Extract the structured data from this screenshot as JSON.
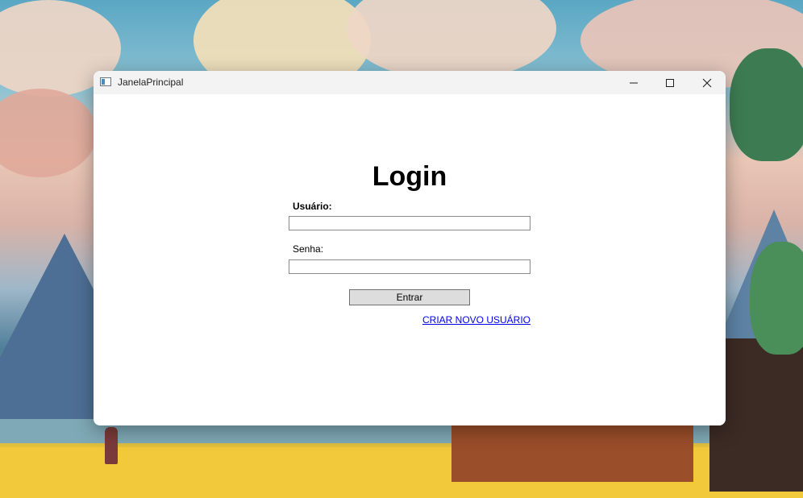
{
  "window": {
    "title": "JanelaPrincipal"
  },
  "titlebar_buttons": {
    "minimize_icon": "minimize-icon",
    "maximize_icon": "maximize-icon",
    "close_icon": "close-icon"
  },
  "login": {
    "heading": "Login",
    "username_label": "Usuário:",
    "username_value": "",
    "password_label": "Senha:",
    "password_value": "",
    "submit_label": "Entrar",
    "create_user_link": "CRIAR NOVO USUÁRIO"
  }
}
